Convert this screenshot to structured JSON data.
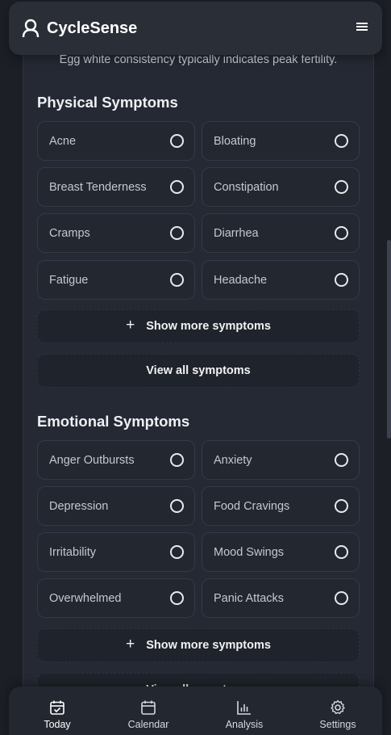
{
  "app": {
    "title": "CycleSense"
  },
  "fertility_note": "Egg white consistency typically indicates peak fertility.",
  "physical": {
    "title": "Physical Symptoms",
    "items": [
      {
        "label": "Acne",
        "checked": false
      },
      {
        "label": "Bloating",
        "checked": false
      },
      {
        "label": "Breast Tenderness",
        "checked": false
      },
      {
        "label": "Constipation",
        "checked": false
      },
      {
        "label": "Cramps",
        "checked": false
      },
      {
        "label": "Diarrhea",
        "checked": false
      },
      {
        "label": "Fatigue",
        "checked": false
      },
      {
        "label": "Headache",
        "checked": false
      }
    ],
    "show_more": "Show more symptoms",
    "view_all": "View all symptoms"
  },
  "emotional": {
    "title": "Emotional Symptoms",
    "items": [
      {
        "label": "Anger Outbursts",
        "checked": false
      },
      {
        "label": "Anxiety",
        "checked": false
      },
      {
        "label": "Depression",
        "checked": false
      },
      {
        "label": "Food Cravings",
        "checked": false
      },
      {
        "label": "Irritability",
        "checked": false
      },
      {
        "label": "Mood Swings",
        "checked": false
      },
      {
        "label": "Overwhelmed",
        "checked": false
      },
      {
        "label": "Panic Attacks",
        "checked": false
      }
    ],
    "show_more": "Show more symptoms",
    "view_all": "View all symptoms"
  },
  "nav": {
    "items": [
      {
        "label": "Today",
        "icon": "calendar-check-icon",
        "active": true
      },
      {
        "label": "Calendar",
        "icon": "calendar-icon",
        "active": false
      },
      {
        "label": "Analysis",
        "icon": "bar-chart-icon",
        "active": false
      },
      {
        "label": "Settings",
        "icon": "gear-icon",
        "active": false
      }
    ]
  },
  "colors": {
    "background": "#1c1f26",
    "card": "#252933",
    "chip": "#232730",
    "header": "#2a2e37",
    "text": "#e8eaed"
  }
}
